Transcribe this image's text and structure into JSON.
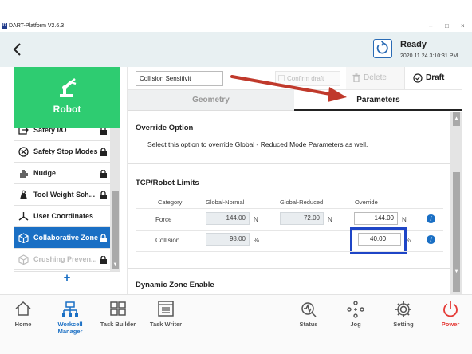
{
  "titlebar": {
    "app_logo": "D",
    "app_title": "DART-Platform V2.6.3",
    "minimize": "–",
    "maximize": "□",
    "close": "×"
  },
  "header": {
    "status_title": "Ready",
    "status_time": "2020.11.24 3:10:31 PM"
  },
  "sidebar": {
    "robot_label": "Robot",
    "items": [
      {
        "label": "Safety I/O",
        "icon": "io-icon",
        "locked": true
      },
      {
        "label": "Safety Stop Modes",
        "icon": "stop-icon",
        "locked": true
      },
      {
        "label": "Nudge",
        "icon": "hand-icon",
        "locked": true
      },
      {
        "label": "Tool Weight Sch...",
        "icon": "weight-icon",
        "locked": true
      },
      {
        "label": "User Coordinates",
        "icon": "axes-icon",
        "locked": false
      },
      {
        "label": "Collaborative Zone",
        "icon": "cube-icon",
        "locked": true,
        "active": true
      },
      {
        "label": "Crushing Preven...",
        "icon": "cube-icon",
        "locked": true,
        "faded": true
      }
    ],
    "add_label": "+"
  },
  "main": {
    "name_value": "Collision Sensitivit",
    "confirm_draft": "Confirm draft",
    "delete_label": "Delete",
    "draft_label": "Draft",
    "tabs": {
      "geometry": "Geometry",
      "parameters": "Parameters"
    },
    "override_section": {
      "title": "Override Option",
      "checkbox_text": "Select this option to override Global - Reduced Mode Parameters as well."
    },
    "limits_section": {
      "title": "TCP/Robot Limits",
      "columns": [
        "Category",
        "Global-Normal",
        "Global-Reduced",
        "Override"
      ],
      "rows": [
        {
          "category": "Force",
          "global_normal": "144.00",
          "global_normal_unit": "N",
          "global_reduced": "72.00",
          "global_reduced_unit": "N",
          "override": "144.00",
          "override_unit": "N"
        },
        {
          "category": "Collision",
          "global_normal": "98.00",
          "global_normal_unit": "%",
          "global_reduced": "",
          "global_reduced_unit": "",
          "override": "40.00",
          "override_unit": "%"
        }
      ]
    },
    "dynamic_section": {
      "title": "Dynamic Zone Enable"
    }
  },
  "bottom_nav": [
    {
      "label": "Home",
      "icon": "home-icon"
    },
    {
      "label": "Workcell Manager",
      "icon": "workcell-icon",
      "active": true
    },
    {
      "label": "Task Builder",
      "icon": "task-builder-icon"
    },
    {
      "label": "Task Writer",
      "icon": "task-writer-icon"
    },
    {
      "label": "Status",
      "icon": "status-icon"
    },
    {
      "label": "Jog",
      "icon": "jog-icon"
    },
    {
      "label": "Setting",
      "icon": "gear-icon"
    },
    {
      "label": "Power",
      "icon": "power-icon"
    }
  ],
  "colors": {
    "accent": "#1a6fc4",
    "robot_tile": "#2ecc71",
    "annotation_arrow": "#c0392b",
    "highlight_box": "#1e45c6",
    "power": "#e53935"
  }
}
